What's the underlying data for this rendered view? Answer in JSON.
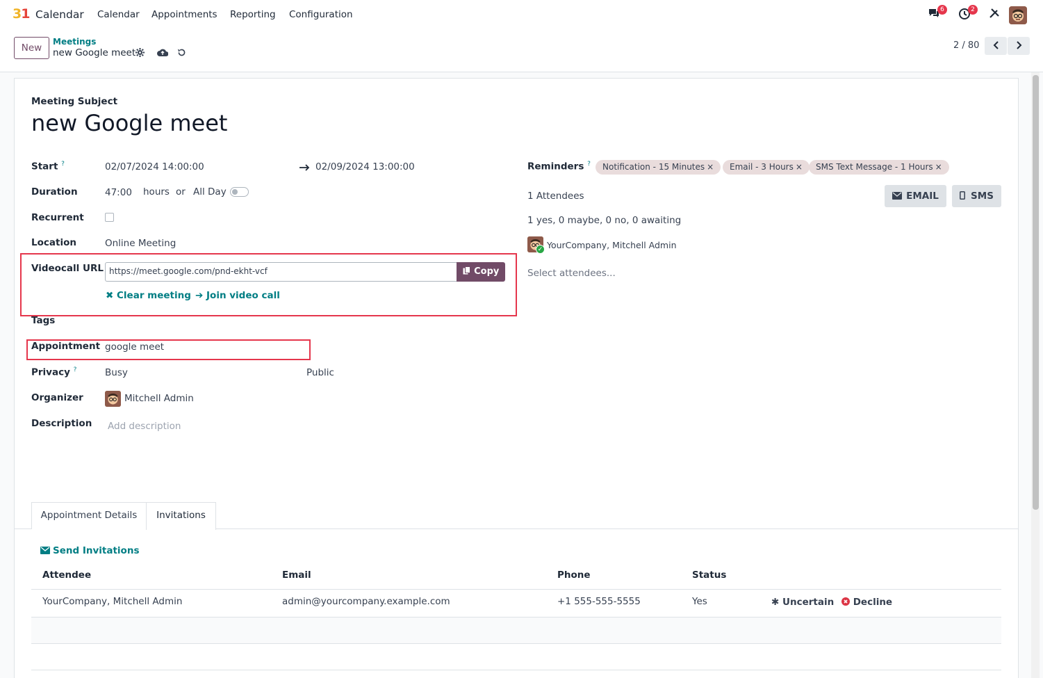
{
  "navbar": {
    "app_icon": "31",
    "app_title": "Calendar",
    "menu": [
      "Calendar",
      "Appointments",
      "Reporting",
      "Configuration"
    ],
    "messages_badge": "6",
    "activities_badge": "2"
  },
  "control": {
    "new_label": "New",
    "breadcrumb_parent": "Meetings",
    "breadcrumb_current": "new Google meet",
    "pager": "2 / 80"
  },
  "form": {
    "subject_label": "Meeting Subject",
    "subject": "new Google meet",
    "start_label": "Start",
    "start_help": "?",
    "start_value": "02/07/2024 14:00:00",
    "stop_value": "02/09/2024 13:00:00",
    "duration_label": "Duration",
    "duration_value": "47:00",
    "hours_label": "hours",
    "or_label": "or",
    "allday_label": "All Day",
    "recurrent_label": "Recurrent",
    "location_label": "Location",
    "location_value": "Online Meeting",
    "videocall_label": "Videocall URL",
    "videocall_url": "https://meet.google.com/pnd-ekht-vcf",
    "copy_label": "Copy",
    "clear_meeting_label": "Clear meeting",
    "join_call_label": "Join video call",
    "tags_label": "Tags",
    "appointment_label": "Appointment",
    "appointment_value": "google meet",
    "privacy_label": "Privacy",
    "privacy_help": "?",
    "privacy_value": "Busy",
    "show_as_value": "Public",
    "organizer_label": "Organizer",
    "organizer_value": "Mitchell Admin",
    "description_label": "Description",
    "description_placeholder": "Add description",
    "reminders_label": "Reminders",
    "reminders_help": "?",
    "reminders": [
      "Notification - 15 Minutes",
      "Email - 3 Hours",
      "SMS Text Message - 1 Hours"
    ],
    "attendees_count": "1 Attendees",
    "email_label": "EMAIL",
    "sms_label": "SMS",
    "attendee_summary": "1 yes, 0 maybe, 0 no, 0 awaiting",
    "attendee_name": "YourCompany, Mitchell Admin",
    "select_attendees_placeholder": "Select attendees..."
  },
  "tabs": [
    "Appointment Details",
    "Invitations"
  ],
  "invitations": {
    "send_label": "Send Invitations",
    "columns": [
      "Attendee",
      "Email",
      "Phone",
      "Status"
    ],
    "rows": [
      {
        "attendee": "YourCompany, Mitchell Admin",
        "email": "admin@yourcompany.example.com",
        "phone": "+1 555-555-5555",
        "status": "Yes",
        "uncertain_label": "Uncertain",
        "decline_label": "Decline"
      }
    ]
  },
  "colors": {
    "brand": "#714b67",
    "link": "#017e84",
    "highlight": "#e5364c"
  }
}
